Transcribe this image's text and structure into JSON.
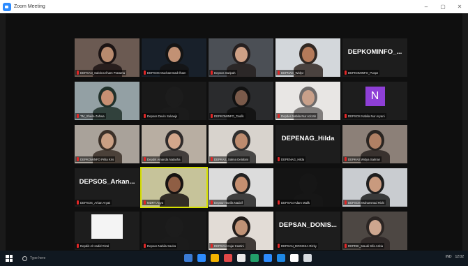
{
  "window": {
    "title": "Zoom Meeting",
    "controls": [
      "–",
      "▢",
      "✕"
    ]
  },
  "participants": [
    {
      "name": "DEPSAN_Sabrina Ilham Pratama",
      "kind": "video"
    },
    {
      "name": "DEPSOS Muchammad Ilham",
      "kind": "video"
    },
    {
      "name": "Depsos Saripah",
      "kind": "video"
    },
    {
      "name": "DEPNAG_Widya",
      "kind": "video"
    },
    {
      "name": "DEPKOMINFO_Puspa",
      "kind": "text",
      "display": "DEPKOMINFO_..."
    },
    {
      "name": "TM_Sheila Zahwa",
      "kind": "video"
    },
    {
      "name": "Depsos Devin Sukaeja",
      "kind": "video"
    },
    {
      "name": "DEPKOMINFO_Taufik",
      "kind": "video"
    },
    {
      "name": "Depdes Nabila Nur Azizah",
      "kind": "video"
    },
    {
      "name": "DEPSOS Nabila Nur Aryani",
      "kind": "avatar",
      "display": "N"
    },
    {
      "name": "DEPKOMINFO Prilia Kris",
      "kind": "video"
    },
    {
      "name": "Depdik Amanda Natasha",
      "kind": "video"
    },
    {
      "name": "DEPKAS_Salma Delafani",
      "kind": "video"
    },
    {
      "name": "DEPENAG_Hilda",
      "kind": "text",
      "display": "DEPENAG_Hilda"
    },
    {
      "name": "DEPKAS Widya Salman",
      "kind": "video"
    },
    {
      "name": "DEPSOS_Arkan Aryati",
      "kind": "text",
      "display": "DEPSOS_Arkan..."
    },
    {
      "name": "MDRT Agya",
      "kind": "video",
      "active": true
    },
    {
      "name": "Depsur Hanifa Nadzif",
      "kind": "video"
    },
    {
      "name": "DEPSAN Adam Malik",
      "kind": "video"
    },
    {
      "name": "DEPSOS Muhammad Rizki",
      "kind": "video"
    },
    {
      "name": "Depdik Al Hadid Rizal",
      "kind": "white"
    },
    {
      "name": "Depsos Nabila Savira",
      "kind": "video"
    },
    {
      "name": "DEPSAN Anjar Kastini",
      "kind": "video"
    },
    {
      "name": "DEPSAN_DONISKA Rizky",
      "kind": "text",
      "display": "DEPSAN_DONIS..."
    },
    {
      "name": "DEPDIK_Maudi Sifa Azkia",
      "kind": "video"
    }
  ],
  "taskbar": {
    "search_placeholder": "Type here",
    "tray_text": "IND",
    "time": "12:02",
    "apps": [
      "#3a7bd5",
      "#2d8cff",
      "#f4b400",
      "#e04848",
      "#e9e9e9",
      "#22a06b",
      "#2d8cff",
      "#1e88e5",
      "#ffffff",
      "#d6dbe0"
    ]
  }
}
